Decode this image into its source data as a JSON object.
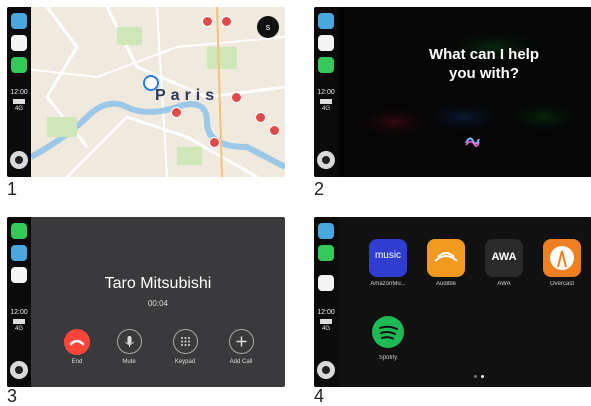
{
  "captions": [
    "1",
    "2",
    "3",
    "4"
  ],
  "status": {
    "time": "12:00",
    "network": "4G"
  },
  "screen1": {
    "city_label": "Paris",
    "fab_glyph": "s"
  },
  "screen2": {
    "prompt_line1": "What can I help",
    "prompt_line2": "you with?"
  },
  "screen3": {
    "caller_name": "Taro Mitsubishi",
    "duration": "00:04",
    "buttons": [
      {
        "label": "End",
        "icon": "end-call-icon"
      },
      {
        "label": "Mute",
        "icon": "mic-icon"
      },
      {
        "label": "Keypad",
        "icon": "keypad-icon"
      },
      {
        "label": "Add Call",
        "icon": "plus-icon"
      }
    ]
  },
  "screen4": {
    "apps": [
      {
        "label": "AmazonMu...",
        "icon_text": "music",
        "color": "#2f3ed1"
      },
      {
        "label": "Audible",
        "icon_text": "",
        "color": "#f39a1e"
      },
      {
        "label": "AWA",
        "icon_text": "AWA",
        "color": "#2a2a2a"
      },
      {
        "label": "Overcast",
        "icon_text": "",
        "color": "#f07f22"
      },
      {
        "label": "Spotify",
        "icon_text": "",
        "color": "#1db954"
      }
    ],
    "page_count": 2,
    "active_page": 2
  }
}
